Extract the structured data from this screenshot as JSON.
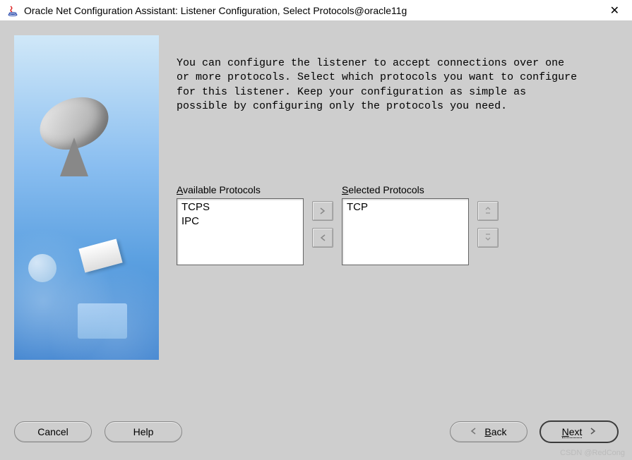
{
  "titlebar": {
    "title": "Oracle Net Configuration Assistant: Listener Configuration, Select Protocols@oracle11g"
  },
  "instruction": "You can configure the listener to accept connections over one or more protocols. Select which protocols you want to configure for this listener. Keep your configuration as simple as possible by configuring only the protocols you need.",
  "shuttle": {
    "available_label_prefix": "A",
    "available_label_rest": "vailable Protocols",
    "selected_label_prefix": "S",
    "selected_label_rest": "elected Protocols",
    "available": [
      "TCPS",
      "IPC"
    ],
    "selected": [
      "TCP"
    ]
  },
  "buttons": {
    "cancel": "Cancel",
    "help": "Help",
    "back_ul": "B",
    "back_rest": "ack",
    "next_ul": "N",
    "next_rest": "ext"
  },
  "watermark": "CSDN @RedCong"
}
